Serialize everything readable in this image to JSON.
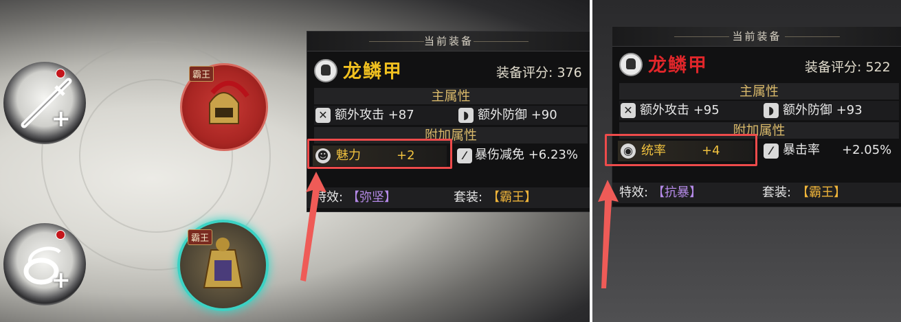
{
  "left_panel": {
    "header_title": "当前装备",
    "item_name": "龙鳞甲",
    "item_name_color": "#f0c020",
    "score_label": "装备评分: ",
    "score_value": "376",
    "main_attr_title": "主属性",
    "stats": [
      {
        "icon": "crossed-swords-icon",
        "text": "额外攻击 +87"
      },
      {
        "icon": "shield-icon",
        "text": "额外防御 +90"
      }
    ],
    "extra_attr_title": "附加属性",
    "bonus": {
      "name": "魅力",
      "value": "+2"
    },
    "secondary": {
      "icon": "blade-icon",
      "text": "暴伤减免 +6.23%"
    },
    "effect_label": "特效:",
    "effect_value": "【弥坚】",
    "set_label": "套装: ",
    "set_value": "【霸王】"
  },
  "right_panel": {
    "header_title": "当前装备",
    "item_name": "龙鳞甲",
    "item_name_color": "#e0262a",
    "score_label": "装备评分: ",
    "score_value": "522",
    "main_attr_title": "主属性",
    "stats": [
      {
        "icon": "crossed-swords-icon",
        "text": "额外攻击 +95"
      },
      {
        "icon": "shield-icon",
        "text": "额外防御 +93"
      }
    ],
    "extra_attr_title": "附加属性",
    "bonus": {
      "name": "统率",
      "value": "+4"
    },
    "secondary": {
      "icon": "blade-icon",
      "text_name": "暴击率",
      "text_value": "+2.05%"
    },
    "effect_label": "特效:",
    "effect_value": "【抗暴】",
    "set_label": "套装: ",
    "set_value": "【霸王】"
  },
  "equipment_slots": [
    {
      "icon": "sword-icon",
      "plus": "+"
    },
    {
      "icon": "amulet-icon",
      "plus": "+"
    }
  ],
  "gear_tags": [
    "霸王",
    "霸王"
  ],
  "colors": {
    "highlight": "#ee4b4b",
    "gold": "#f0b53a",
    "purple": "#b58ae8"
  }
}
